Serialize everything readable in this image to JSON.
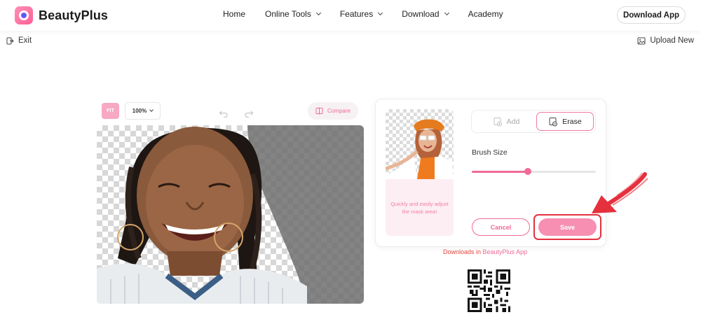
{
  "brand": {
    "name": "BeautyPlus",
    "logo_icon": "camera-logo-icon"
  },
  "nav": {
    "links": [
      {
        "label": "Home",
        "has_dropdown": false
      },
      {
        "label": "Online Tools",
        "has_dropdown": true
      },
      {
        "label": "Features",
        "has_dropdown": true
      },
      {
        "label": "Download",
        "has_dropdown": true
      },
      {
        "label": "Academy",
        "has_dropdown": false
      }
    ],
    "download_app_label": "Download App"
  },
  "subbar": {
    "exit_label": "Exit",
    "upload_label": "Upload New"
  },
  "toolbar": {
    "fit_label": "FIT",
    "zoom_value": "100%",
    "compare_label": "Compare"
  },
  "panel": {
    "preview_text": "Quickly and easily adjust the mask area!",
    "modes": {
      "add_label": "Add",
      "erase_label": "Erase",
      "active": "Erase"
    },
    "brush_label": "Brush Size",
    "brush_value": 0.45,
    "cancel_label": "Cancel",
    "save_label": "Save"
  },
  "downloads": {
    "prefix": "Downloads in ",
    "app": "BeautyPlus App"
  },
  "colors": {
    "accent": "#f06a97",
    "highlight": "#e5303e",
    "save_fill": "#f78fb3"
  }
}
